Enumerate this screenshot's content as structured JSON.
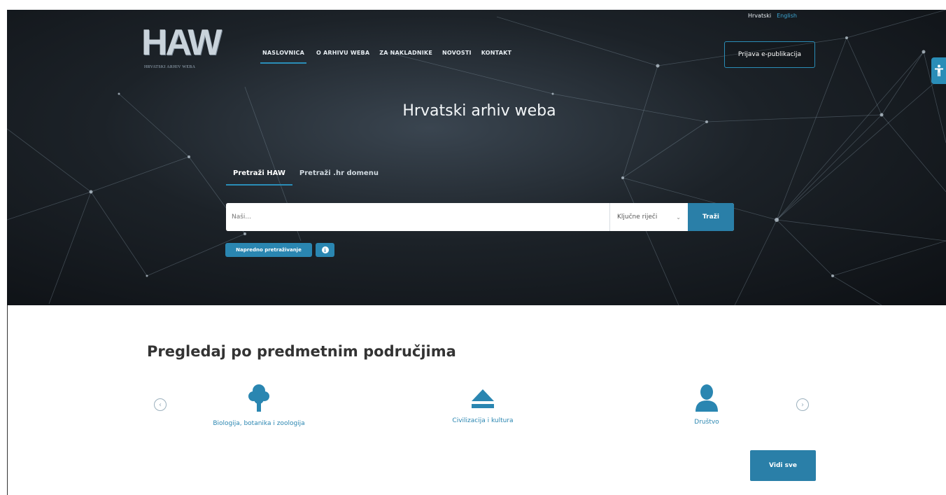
{
  "header": {
    "logo_text": "HAW",
    "logo_subtitle": "HRVATSKI ARHIV WEBA",
    "nav": [
      {
        "label": "NASLOVNICA",
        "active": true
      },
      {
        "label": "O ARHIVU WEBA"
      },
      {
        "label": "ZA NAKLADNIKE"
      },
      {
        "label": "NOVOSTI"
      },
      {
        "label": "KONTAKT"
      }
    ],
    "languages": {
      "current": "Hrvatski",
      "other": "English"
    },
    "login_label": "Prijava e-publikacija"
  },
  "accessibility_icon": "accessibility-person-icon",
  "hero": {
    "title": "Hrvatski arhiv weba",
    "tabs": [
      "Pretraži HAW",
      "Pretraži .hr domenu"
    ],
    "search": {
      "placeholder": "Naši...",
      "select_value": "Ključne riječi",
      "button_label": "Traži"
    },
    "advanced_label": "Napredno pretraživanje",
    "info_icon": "info-icon"
  },
  "browse": {
    "title": "Pregledaj po predmetnim područjima",
    "categories": [
      {
        "label": "Biologija, botanika i zoologija",
        "icon": "tree-icon"
      },
      {
        "label": "Civilizacija i kultura",
        "icon": "eject-icon"
      },
      {
        "label": "Društvo",
        "icon": "person-icon"
      }
    ],
    "see_all_label": "Vidi sve"
  },
  "colors": {
    "accent": "#2a86b1",
    "hero_dark": "#1c2228",
    "text_dark": "#333333"
  }
}
